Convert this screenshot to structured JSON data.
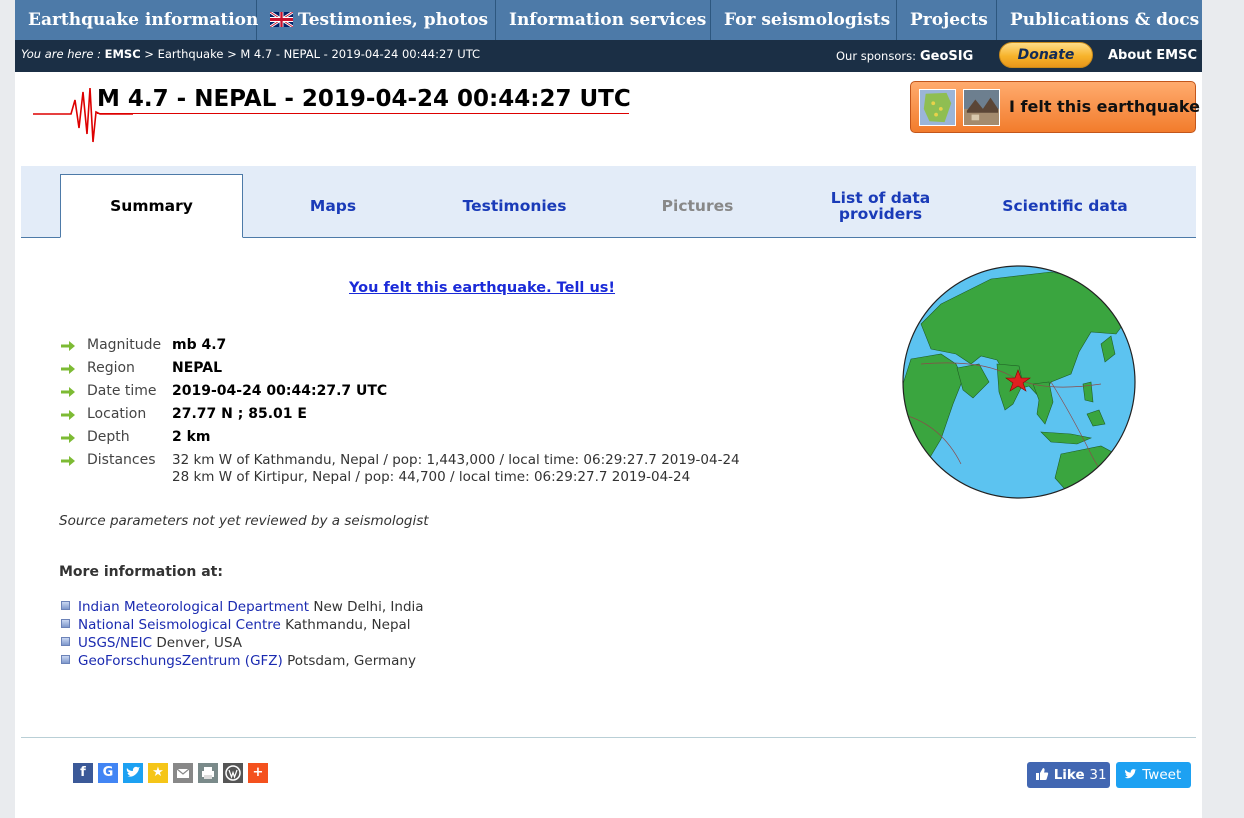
{
  "nav": {
    "items": [
      {
        "label": "Earthquake information"
      },
      {
        "label": "Testimonies, photos"
      },
      {
        "label": "Information services"
      },
      {
        "label": "For seismologists"
      },
      {
        "label": "Projects"
      },
      {
        "label": "Publications & docs"
      }
    ]
  },
  "breadcrumb": {
    "prefix": "You are here :",
    "home": "EMSC",
    "sep1": ">",
    "section": "Earthquake",
    "sep2": ">",
    "current": "M 4.7 - NEPAL - 2019-04-24 00:44:27 UTC"
  },
  "sponsors": {
    "label": "Our sponsors:",
    "name": "GeoSIG"
  },
  "donate": {
    "label": "Donate"
  },
  "about": {
    "label": "About EMSC"
  },
  "header": {
    "title": "M 4.7 - NEPAL - 2019-04-24 00:44:27 UTC",
    "felt_button": "I felt this earthquake"
  },
  "tabs": {
    "summary": "Summary",
    "maps": "Maps",
    "testimonies": "Testimonies",
    "pictures": "Pictures",
    "providers_line1": "List of data",
    "providers_line2": "providers",
    "scientific": "Scientific data"
  },
  "main": {
    "tell_us": "You felt this earthquake. Tell us!",
    "details": {
      "magnitude_label": "Magnitude",
      "magnitude": "mb 4.7",
      "region_label": "Region",
      "region": "NEPAL",
      "datetime_label": "Date time",
      "datetime": "2019-04-24 00:44:27.7 UTC",
      "location_label": "Location",
      "location": "27.77 N ; 85.01 E",
      "depth_label": "Depth",
      "depth": "2 km",
      "distances_label": "Distances",
      "distance_1": "32 km W of Kathmandu, Nepal / pop: 1,443,000 / local time: 06:29:27.7 2019-04-24",
      "distance_2": "28 km W of Kirtipur, Nepal / pop: 44,700 / local time: 06:29:27.7 2019-04-24"
    },
    "source_note": "Source parameters not yet reviewed by a seismologist",
    "more_info_title": "More information at:",
    "links": [
      {
        "name": "Indian Meteorological Department",
        "place": "New Delhi, India"
      },
      {
        "name": "National Seismological Centre",
        "place": "Kathmandu, Nepal"
      },
      {
        "name": "USGS/NEIC",
        "place": "Denver, USA"
      },
      {
        "name": "GeoForschungsZentrum (GFZ)",
        "place": "Potsdam, Germany"
      }
    ]
  },
  "social": {
    "like_label": "Like",
    "like_count": "31",
    "tweet_label": "Tweet"
  },
  "colors": {
    "nav_bg": "#4d7aa8",
    "crumb_bg": "#1b2f45",
    "tab_bg": "#e3ecf8",
    "felt_orange": "#f27c2c",
    "link_blue": "#1a2ad8"
  }
}
